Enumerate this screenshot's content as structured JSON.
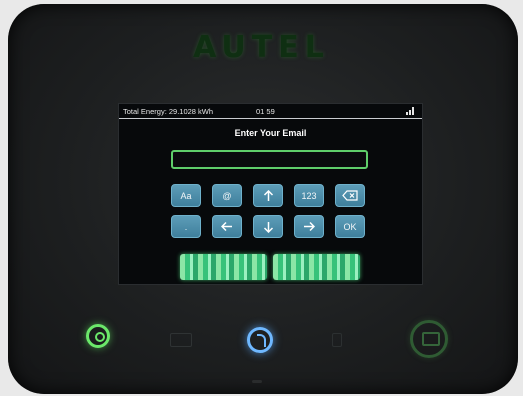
{
  "brand": {
    "logo_text": "AUTEL"
  },
  "status_bar": {
    "energy": "Total Energy: 29.1028 kWh",
    "time": "01 59",
    "signal_icon": "signal-icon"
  },
  "prompt": {
    "title": "Enter Your Email"
  },
  "email_field": {
    "value": "",
    "placeholder": ""
  },
  "keyboard": {
    "row1": [
      {
        "label": "Aa"
      },
      {
        "label": "@"
      },
      {
        "label": "",
        "icon": "arrow-up-icon"
      },
      {
        "label": "123"
      },
      {
        "label": "",
        "icon": "backspace-icon"
      }
    ],
    "row2": [
      {
        "label": "."
      },
      {
        "label": "",
        "icon": "arrow-left-icon"
      },
      {
        "label": "",
        "icon": "arrow-down-icon"
      },
      {
        "label": "",
        "icon": "arrow-right-icon"
      },
      {
        "label": "OK"
      }
    ]
  },
  "actions": {
    "left_label": "",
    "right_label": ""
  },
  "hardware": {
    "power_icon": "power-icon",
    "rfid_icon": "rfid-icon",
    "accent_green": "#6be76a",
    "accent_blue": "#6fb8ff"
  }
}
